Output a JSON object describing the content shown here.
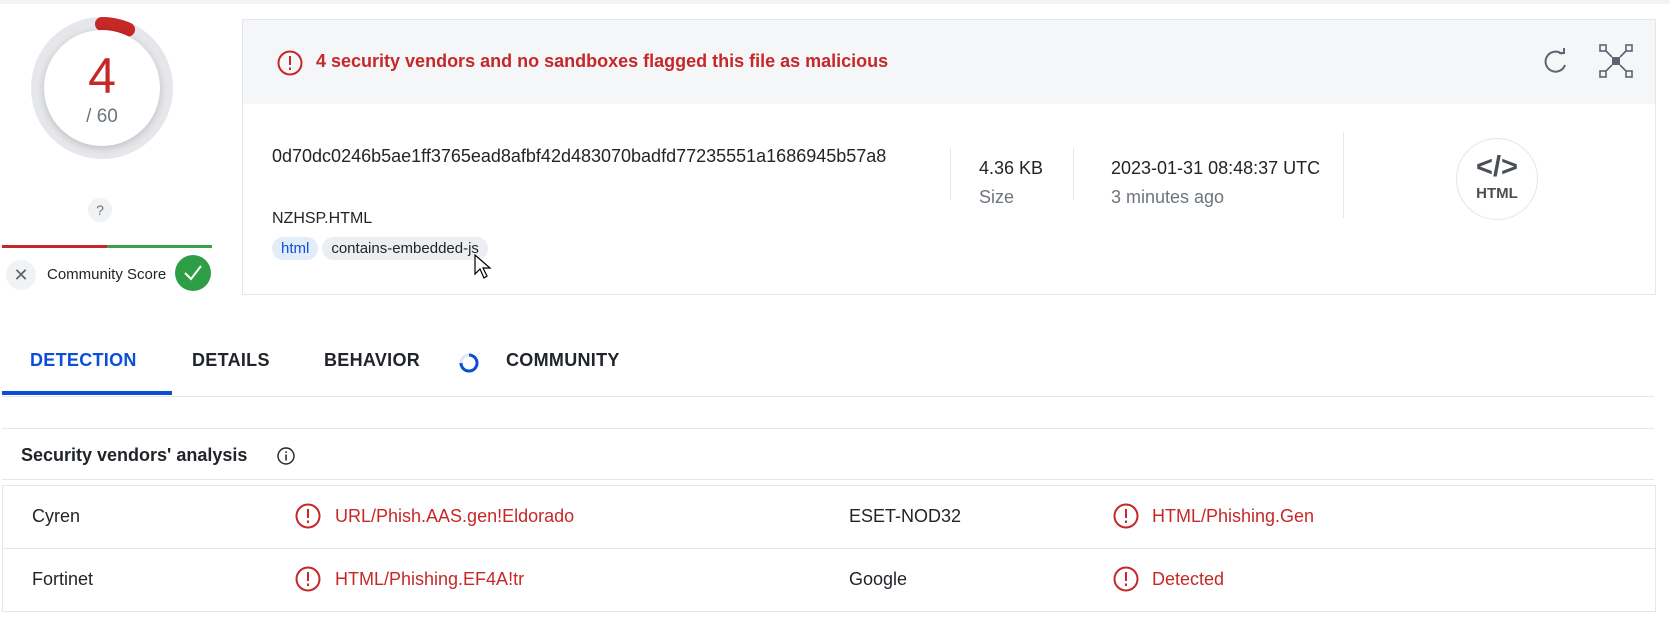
{
  "score": {
    "detections": "4",
    "total": "/ 60",
    "question": "?",
    "community_label": "Community Score",
    "ratio": 0.0667
  },
  "alert": {
    "text": "4 security vendors and no sandboxes flagged this file as malicious"
  },
  "file": {
    "hash": "0d70dc0246b5ae1ff3765ead8afbf42d483070badfd77235551a1686945b57a8",
    "name": "NZHSP.HTML",
    "tags": [
      "html",
      "contains-embedded-js"
    ],
    "size": "4.36 KB",
    "size_label": "Size",
    "date": "2023-01-31 08:48:37 UTC",
    "date_relative": "3 minutes ago",
    "type_glyph": "</>",
    "type_label": "HTML"
  },
  "tabs": [
    "DETECTION",
    "DETAILS",
    "BEHAVIOR",
    "COMMUNITY"
  ],
  "vendors": {
    "title": "Security vendors' analysis",
    "rows": [
      [
        {
          "vendor": "Cyren",
          "result": "URL/Phish.AAS.gen!Eldorado"
        },
        {
          "vendor": "ESET-NOD32",
          "result": "HTML/Phishing.Gen"
        }
      ],
      [
        {
          "vendor": "Fortinet",
          "result": "HTML/Phishing.EF4A!tr"
        },
        {
          "vendor": "Google",
          "result": "Detected"
        }
      ]
    ]
  },
  "colors": {
    "malicious": "#c62828",
    "accent": "#0b4fd6",
    "harmless": "#2e9e46"
  }
}
